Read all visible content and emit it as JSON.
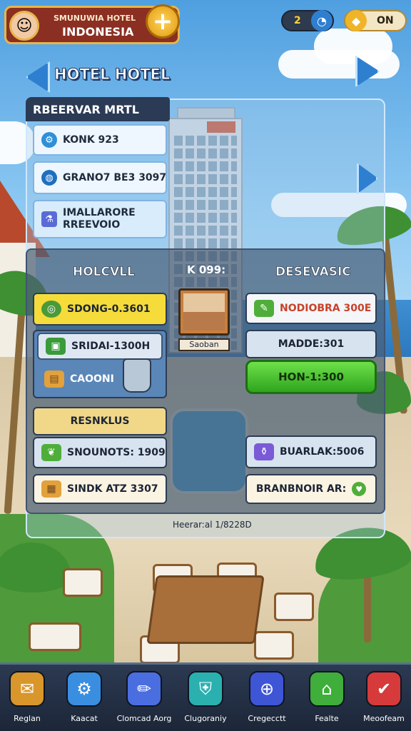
{
  "header": {
    "badge_line1": "SMUNUWIA HOTEL",
    "badge_line2": "INDONESIA",
    "plus_symbol": "+",
    "currency_value": "2",
    "gem_value": "ON"
  },
  "title": "HOTEL HOTEL",
  "reservation": {
    "header": "RBEERVAR MRTL",
    "items": [
      {
        "label": "KONK 923",
        "icon": "gear-icon"
      },
      {
        "label": "GRANO7 BE3 3097",
        "icon": "compass-icon"
      },
      {
        "label": "IMALLARORE\nRREEVOIO",
        "icon": "flask-icon"
      }
    ]
  },
  "board": {
    "left_title": "HOLCVLL",
    "mid_label": "K 099:",
    "right_title": "DESEVASIC",
    "left_cards": {
      "top": "SDONG-0.3601",
      "stack": "SRIDAI-1300H",
      "chest": "CAOONI",
      "section": "RESNKLUS",
      "item1": "SNOUNOTS: 1909",
      "item2": "SINDK ATZ 3307"
    },
    "room_caption": "Saoban",
    "right_cards": {
      "top": "NODIOBRA 300E",
      "mid": "MADDE:301",
      "button": "HON-1:300",
      "item1": "BUARLAK:5006",
      "item2": "BRANBNOIR AR:"
    },
    "footer": "Heerar:al 1/8228D"
  },
  "nav": [
    {
      "label": "Reglan",
      "icon": "scroll-icon",
      "color": "#d9962b"
    },
    {
      "label": "Kaacat",
      "icon": "gear-icon",
      "color": "#3a8ee0"
    },
    {
      "label": "Clomcad Aorg",
      "icon": "pencil-icon",
      "color": "#4a6ee0"
    },
    {
      "label": "Clugoraniy",
      "icon": "shield-icon",
      "color": "#2bb0b0"
    },
    {
      "label": "Cregecctt",
      "icon": "crosshair-icon",
      "color": "#3e55d6"
    },
    {
      "label": "Fealte",
      "icon": "home-icon",
      "color": "#3fae3a"
    },
    {
      "label": "Meoofeam",
      "icon": "mail-icon",
      "color": "#d63a3a"
    }
  ]
}
